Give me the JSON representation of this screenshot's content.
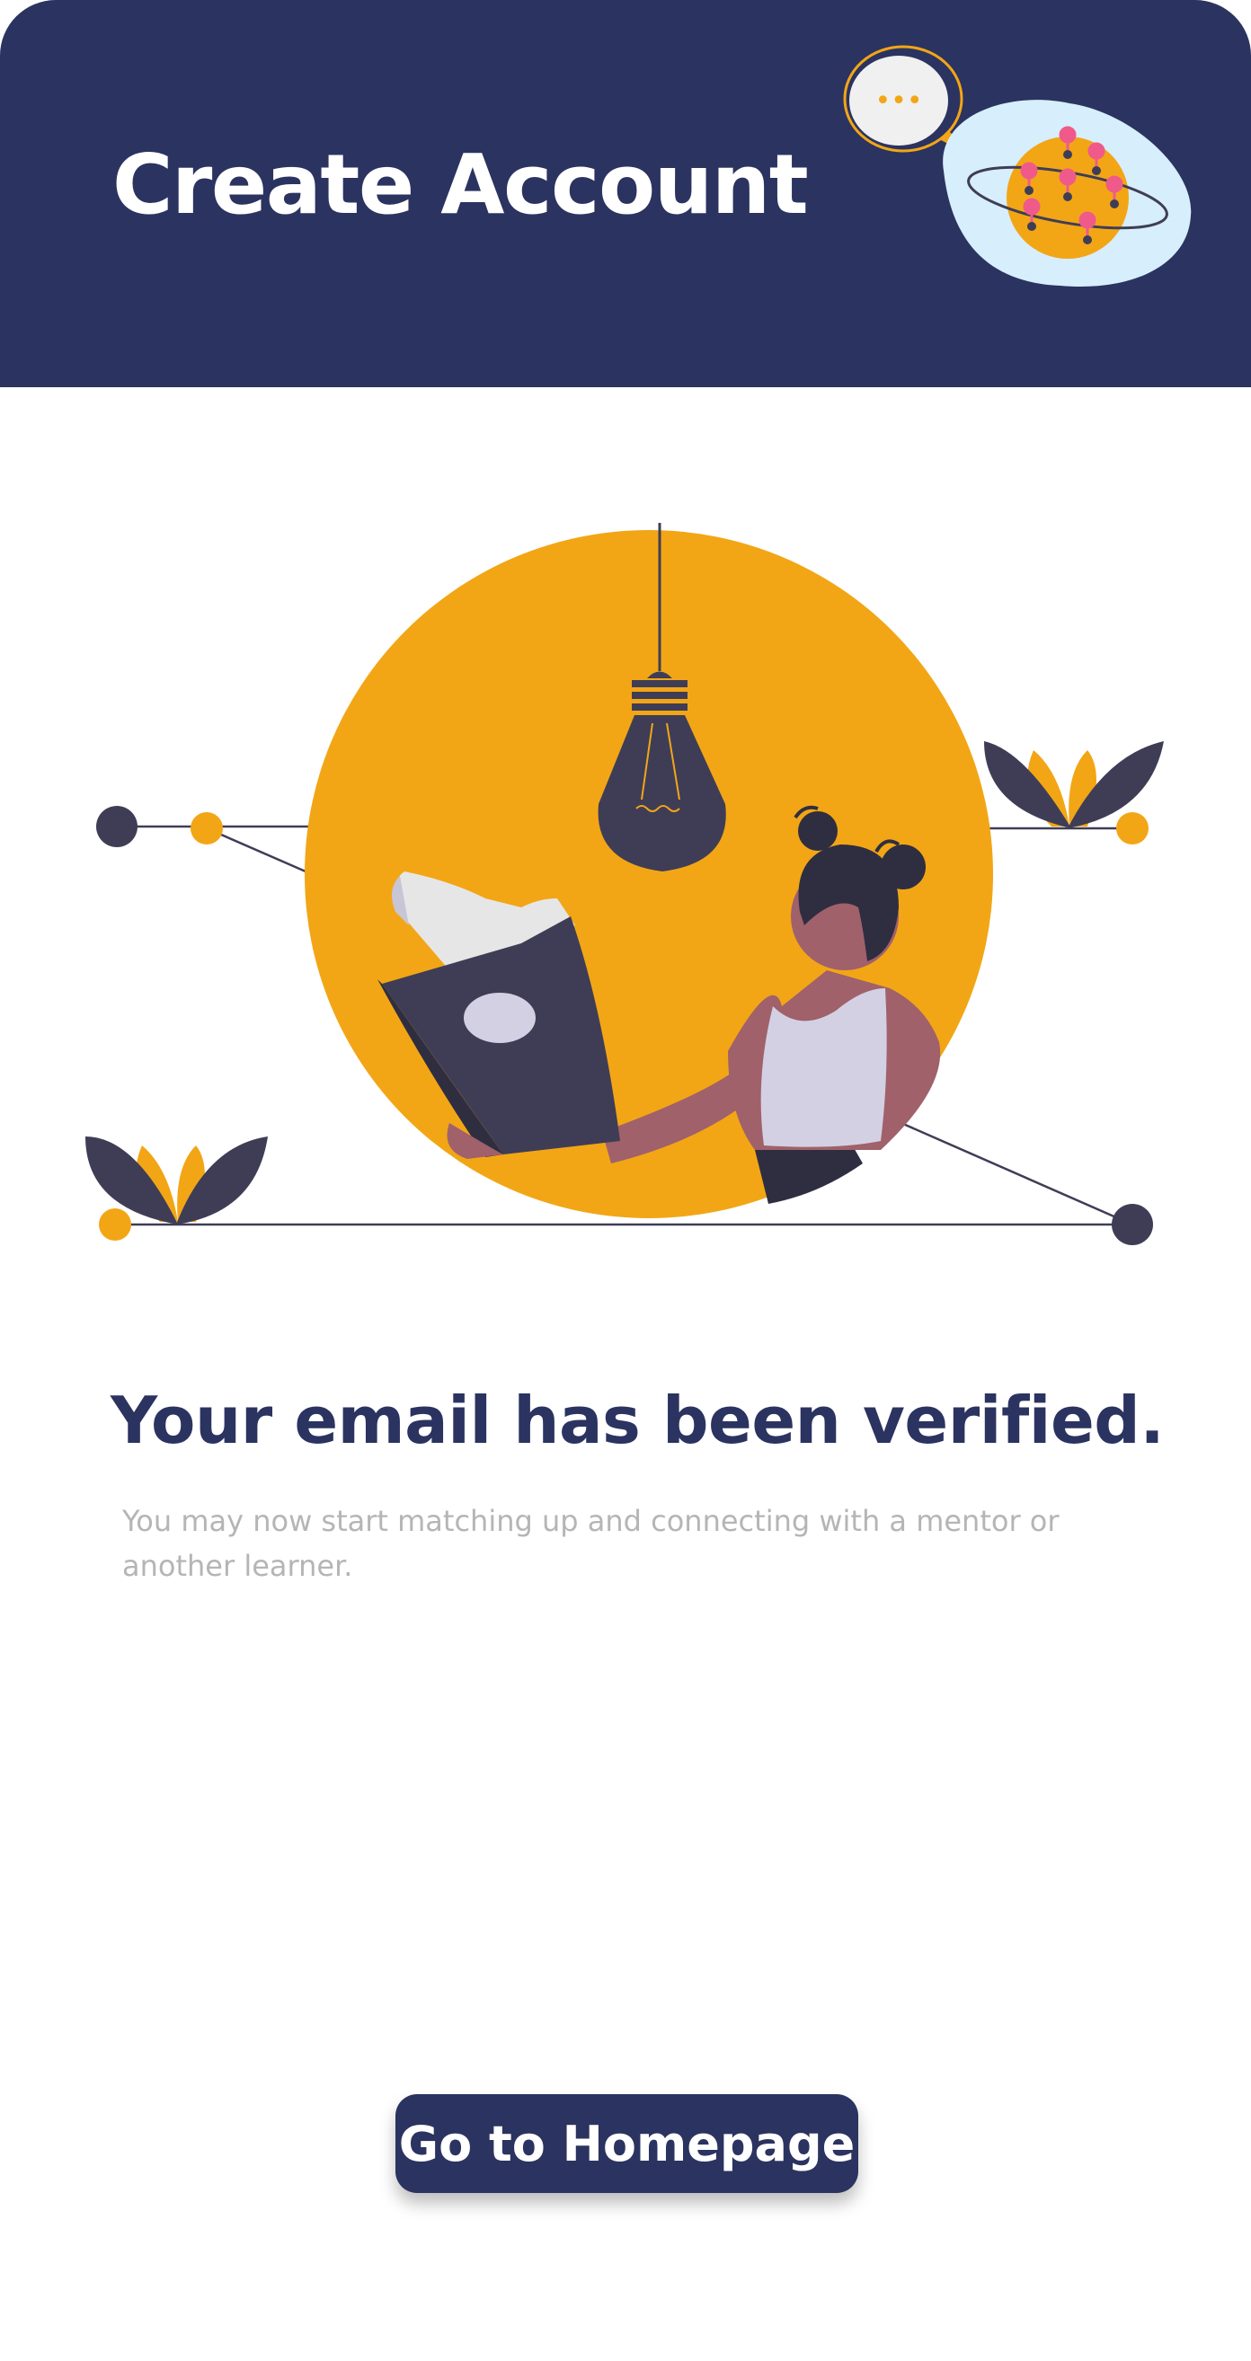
{
  "header": {
    "title": "Create Account",
    "background": "#2b3360",
    "chat_bubble_glyph": "•••"
  },
  "colors": {
    "navy": "#2b3360",
    "accent_orange": "#f2a616",
    "dark": "#3f3d56",
    "muted_text": "#b5b5b5",
    "pin_pink": "#f05a8a",
    "globe_bg": "#d7eefc"
  },
  "illustration": {
    "header_art": "globe-with-location-pins-and-chat-bubble",
    "hero_art": "woman-reading-book-under-lightbulb"
  },
  "main": {
    "headline": "Your email has been verified.",
    "subtext": "You may now start matching up and connecting with a mentor or another learner."
  },
  "actions": {
    "primary_label": "Go to Homepage"
  }
}
